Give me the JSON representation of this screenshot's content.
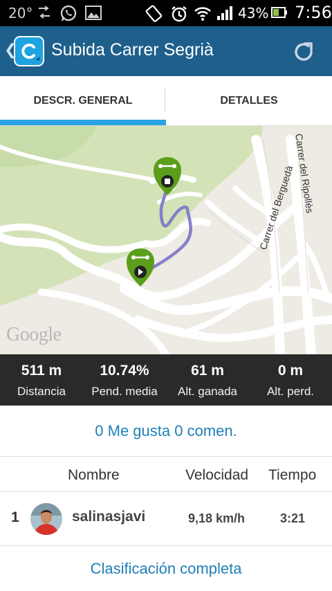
{
  "status_bar": {
    "temperature": "20°",
    "battery": "43%",
    "time": "7:56",
    "icons": [
      "data-transfer-icon",
      "whatsapp-icon",
      "image-icon",
      "rotation-icon",
      "alarm-icon",
      "wifi-icon",
      "signal-icon",
      "battery-icon"
    ]
  },
  "app_bar": {
    "title": "Subida Carrer Segrià",
    "accent": "#1e5f8c"
  },
  "tabs": [
    {
      "label": "DESCR. GENERAL",
      "active": true
    },
    {
      "label": "DETALLES",
      "active": false
    }
  ],
  "map": {
    "attribution": "Google",
    "streets": [
      "Carrer del Berguedà",
      "Carrer del Ripollès"
    ],
    "route_color": "#7b73c9",
    "marker_color": "#5a9e1c"
  },
  "stats": [
    {
      "value": "511 m",
      "label": "Distancia"
    },
    {
      "value": "10.74%",
      "label": "Pend. media"
    },
    {
      "value": "61 m",
      "label": "Alt. ganada"
    },
    {
      "value": "0 m",
      "label": "Alt. perd."
    }
  ],
  "social": {
    "text": "0 Me gusta 0 comen."
  },
  "leaderboard": {
    "headers": {
      "name": "Nombre",
      "speed": "Velocidad",
      "time": "Tiempo"
    },
    "rows": [
      {
        "rank": "1",
        "name": "salinasjavi",
        "speed": "9,18 km/h",
        "time": "3:21"
      }
    ],
    "full_link": "Clasificación completa"
  }
}
